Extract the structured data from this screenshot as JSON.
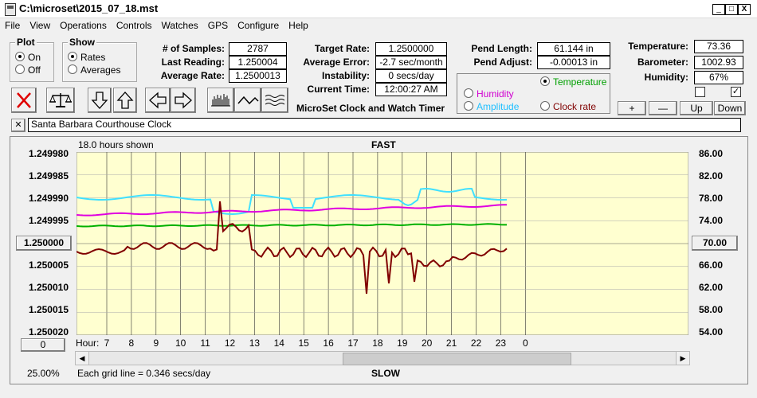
{
  "window": {
    "title": "C:\\microset\\2015_07_18.mst",
    "min": "_",
    "max": "□",
    "close": "X"
  },
  "menu": [
    "File",
    "View",
    "Operations",
    "Controls",
    "Watches",
    "GPS",
    "Configure",
    "Help"
  ],
  "plot_group": {
    "title": "Plot",
    "on": "On",
    "off": "Off"
  },
  "show_group": {
    "title": "Show",
    "rates": "Rates",
    "averages": "Averages"
  },
  "stats": {
    "samples_label": "# of Samples:",
    "samples": "2787",
    "last_label": "Last Reading:",
    "last": "1.250004",
    "avg_label": "Average Rate:",
    "avg": "1.2500013",
    "target_label": "Target Rate:",
    "target": "1.2500000",
    "avgerr_label": "Average Error:",
    "avgerr": "-2.7 sec/month",
    "inst_label": "Instability:",
    "inst": "0 secs/day",
    "time_label": "Current Time:",
    "time": "12:00:27 AM",
    "pendlen_label": "Pend Length:",
    "pendlen": "61.144 in",
    "pendadj_label": "Pend Adjust:",
    "pendadj": "-0.00013 in",
    "temp_label": "Temperature:",
    "temp": "73.36",
    "baro_label": "Barometer:",
    "baro": "1002.93",
    "hum_label": "Humidity:",
    "hum": "67%"
  },
  "app_name": "MicroSet Clock and Watch Timer",
  "sensor_group": {
    "temperature": "Temperature",
    "humidity": "Humidity",
    "amplitude": "Amplitude",
    "clock_rate": "Clock rate"
  },
  "adj_buttons": {
    "plus": "+",
    "minus": "—",
    "up": "Up",
    "down": "Down"
  },
  "close_x": "✕",
  "clock_name": "Santa Barbara Courthouse Clock",
  "plot": {
    "hours_shown": "18.0 hours shown",
    "fast": "FAST",
    "slow": "SLOW",
    "left_ticks": [
      "1.249980",
      "1.249985",
      "1.249990",
      "1.249995",
      "1.250000",
      "1.250005",
      "1.250010",
      "1.250015",
      "1.250020"
    ],
    "right_ticks": [
      "86.00",
      "82.00",
      "78.00",
      "74.00",
      "70.00",
      "66.00",
      "62.00",
      "58.00",
      "54.00"
    ],
    "left_center_btn": "1.250000",
    "right_center_btn": "70.00",
    "zero_btn": "0",
    "hour_label": "Hour:",
    "hours": [
      "7",
      "8",
      "9",
      "10",
      "11",
      "12",
      "13",
      "14",
      "15",
      "16",
      "17",
      "18",
      "19",
      "20",
      "21",
      "22",
      "23",
      "0"
    ],
    "zoom": "25.00%",
    "grid_note": "Each grid line = 0.346 secs/day",
    "colors": {
      "bg": "#ffffd0",
      "rate": "#800000",
      "temp": "#00b000",
      "humidity": "#e000e0",
      "amplitude": "#40e0ff"
    }
  },
  "icons": {
    "cancel": "red-x-icon",
    "balance": "balance-scale-icon",
    "down": "arrow-down-icon",
    "up": "arrow-up-icon",
    "left": "arrow-left-icon",
    "right": "arrow-right-icon",
    "bars": "bar-graph-icon",
    "wave": "wave-icon",
    "waves": "multi-wave-icon"
  }
}
